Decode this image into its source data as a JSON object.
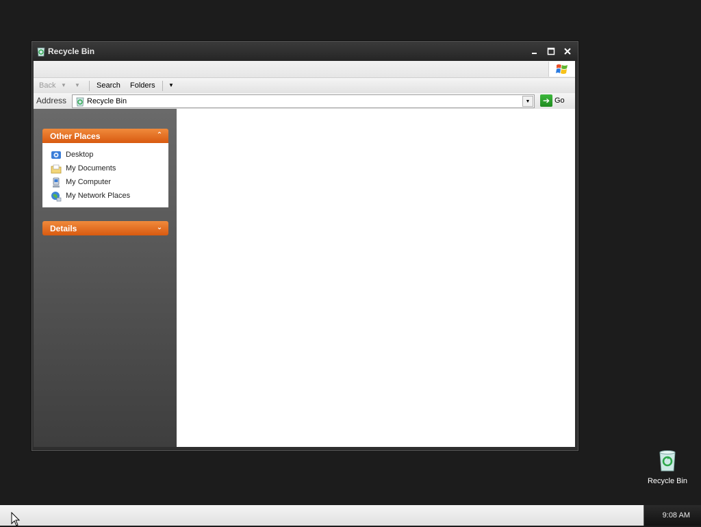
{
  "window": {
    "title": "Recycle Bin",
    "title_icon": "recycle-bin-icon"
  },
  "toolbar": {
    "back_label": "Back",
    "search_label": "Search",
    "folders_label": "Folders"
  },
  "address": {
    "label": "Address",
    "value": "Recycle Bin",
    "go_label": "Go"
  },
  "task_pane": {
    "other_places": {
      "title": "Other Places",
      "items": [
        {
          "label": "Desktop",
          "icon": "desktop-icon"
        },
        {
          "label": "My Documents",
          "icon": "my-documents-icon"
        },
        {
          "label": "My Computer",
          "icon": "my-computer-icon"
        },
        {
          "label": "My Network Places",
          "icon": "network-places-icon"
        }
      ]
    },
    "details": {
      "title": "Details"
    }
  },
  "desktop": {
    "icons": [
      {
        "label": "Recycle Bin",
        "icon": "recycle-bin-icon"
      }
    ]
  },
  "taskbar": {
    "clock": "9:08 AM"
  },
  "colors": {
    "desktop_bg": "#1c1c1c",
    "panel_header": "#e8701e",
    "content_bg": "#ffffff"
  }
}
